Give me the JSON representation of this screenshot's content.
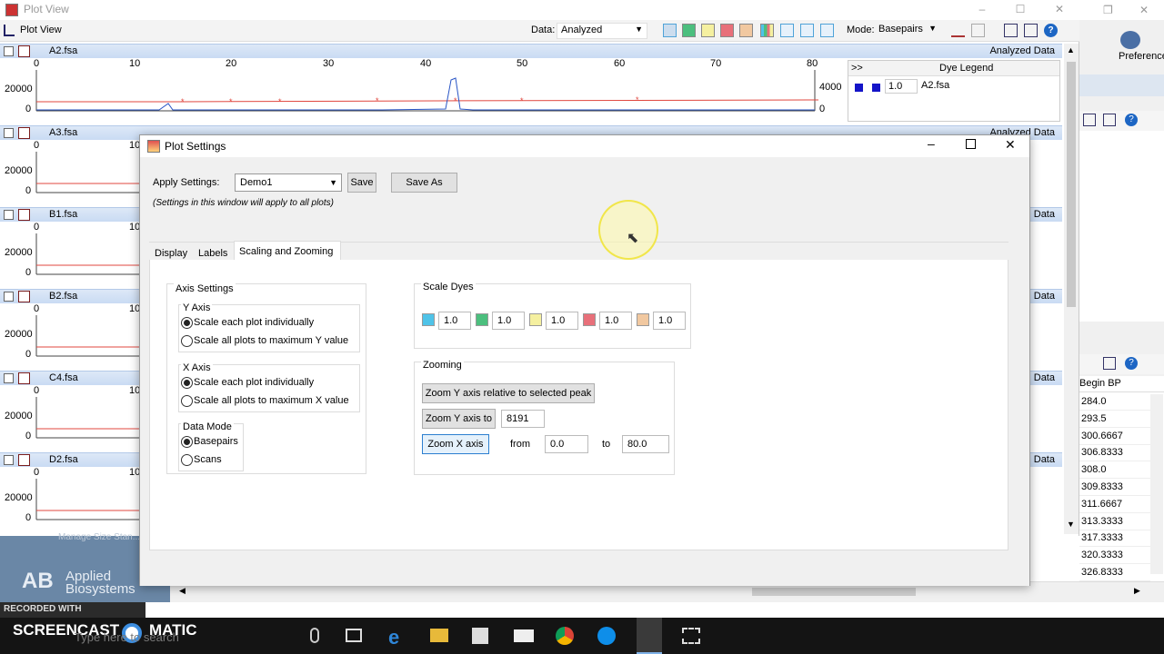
{
  "window": {
    "title": "Plot View",
    "controls": [
      "–",
      "☐",
      "✕"
    ]
  },
  "toolbar": {
    "plot_view_label": "Plot View",
    "data_label": "Data:",
    "data_value": "Analyzed",
    "mode_label": "Mode:",
    "mode_value": "Basepairs"
  },
  "plots": [
    {
      "name": "A2.fsa",
      "right": "Analyzed Data"
    },
    {
      "name": "A3.fsa",
      "right": "Analyzed Data"
    },
    {
      "name": "B1.fsa",
      "right": "Data"
    },
    {
      "name": "B2.fsa",
      "right": "Data"
    },
    {
      "name": "C4.fsa",
      "right": "Data"
    },
    {
      "name": "D2.fsa",
      "right": "Data"
    }
  ],
  "plot_axes": {
    "y_top": "20000",
    "y_zero": "0",
    "x_ticks": [
      "0",
      "10",
      "20",
      "30",
      "40",
      "50",
      "60",
      "70",
      "80"
    ],
    "partial_tick": "10",
    "right_y_top": "4000",
    "right_y_zero": "0"
  },
  "dye_legend": {
    "toggle": ">>",
    "title": "Dye Legend",
    "scale": "1.0",
    "sample": "A2.fsa",
    "color": "#1414c8"
  },
  "side_panel": {
    "preferences": "Preferences",
    "begin_bp_header": "Begin BP",
    "begin_bp_values": [
      "284.0",
      "293.5",
      "300.6667",
      "306.8333",
      "308.0",
      "309.8333",
      "311.6667",
      "313.3333",
      "317.3333",
      "320.3333",
      "326.8333"
    ]
  },
  "branding": {
    "logo_text_1": "Applied",
    "logo_text_2": "Biosystems",
    "logo_mark": "AB",
    "faded_text": "Manage Size Stan..."
  },
  "watermark": {
    "recorded_with": "RECORDED WITH",
    "screencast": "SCREENCAST",
    "matic": "MATIC"
  },
  "taskbar": {
    "search_placeholder": "Type here to search"
  },
  "dialog": {
    "title": "Plot Settings",
    "apply_settings_label": "Apply Settings:",
    "apply_settings_value": "Demo1",
    "save_button": "Save",
    "save_as_button": "Save As",
    "note": "(Settings in this window will apply to all plots)",
    "tabs": [
      "Display",
      "Labels",
      "Scaling and Zooming"
    ],
    "active_tab": "Scaling and Zooming",
    "axis_settings": {
      "title": "Axis Settings",
      "y_axis": {
        "title": "Y Axis",
        "options": [
          "Scale each plot individually",
          "Scale all plots to maximum Y value"
        ],
        "selected": 0
      },
      "x_axis": {
        "title": "X Axis",
        "options": [
          "Scale each plot individually",
          "Scale all plots to maximum X value"
        ],
        "selected": 0
      },
      "data_mode": {
        "title": "Data Mode",
        "options": [
          "Basepairs",
          "Scans"
        ],
        "selected": 0
      }
    },
    "scale_dyes": {
      "title": "Scale Dyes",
      "dyes": [
        {
          "color": "#4fc3e8",
          "value": "1.0"
        },
        {
          "color": "#4cbf7e",
          "value": "1.0"
        },
        {
          "color": "#f5f0a0",
          "value": "1.0"
        },
        {
          "color": "#e8707a",
          "value": "1.0"
        },
        {
          "color": "#f1c8a0",
          "value": "1.0"
        }
      ]
    },
    "zooming": {
      "title": "Zooming",
      "zoom_y_relative_button": "Zoom Y axis relative to selected peak",
      "zoom_y_to_button": "Zoom Y axis to",
      "zoom_y_value": "8191",
      "zoom_x_button": "Zoom X axis",
      "from_label": "from",
      "from_value": "0.0",
      "to_label": "to",
      "to_value": "80.0"
    }
  }
}
